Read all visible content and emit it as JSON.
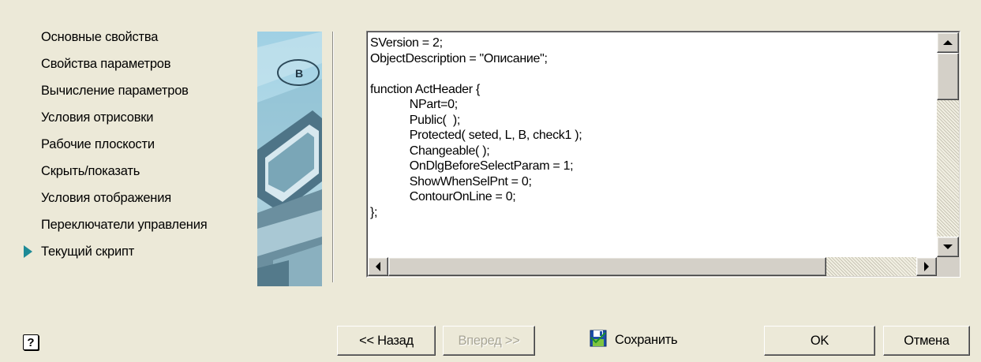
{
  "nav": {
    "items": [
      {
        "label": "Основные свойства"
      },
      {
        "label": "Свойства параметров"
      },
      {
        "label": "Вычисление параметров"
      },
      {
        "label": "Условия отрисовки"
      },
      {
        "label": "Рабочие плоскости"
      },
      {
        "label": "Скрыть/показать"
      },
      {
        "label": "Условия отображения"
      },
      {
        "label": "Переключатели управления"
      },
      {
        "label": "Текущий скрипт",
        "active": true
      }
    ],
    "accent_color": "#1d8a96"
  },
  "banner": {
    "icon": "building-banner-image",
    "badge_text": "B"
  },
  "editor": {
    "lines": [
      "SVersion = 2;",
      "ObjectDescription = \"Описание\";",
      "",
      "function ActHeader {",
      "            NPart=0;",
      "            Public(  );",
      "            Protected( seted, L, B, check1 );",
      "            Changeable( );",
      "            OnDlgBeforeSelectParam = 1;",
      "            ShowWhenSelPnt = 0;",
      "            ContourOnLine = 0;",
      "};"
    ]
  },
  "footer": {
    "help_label": "?",
    "back_label": "<< Назад",
    "next_label": "Вперед >>",
    "save_label": "Сохранить",
    "ok_label": "OK",
    "cancel_label": "Отмена"
  }
}
